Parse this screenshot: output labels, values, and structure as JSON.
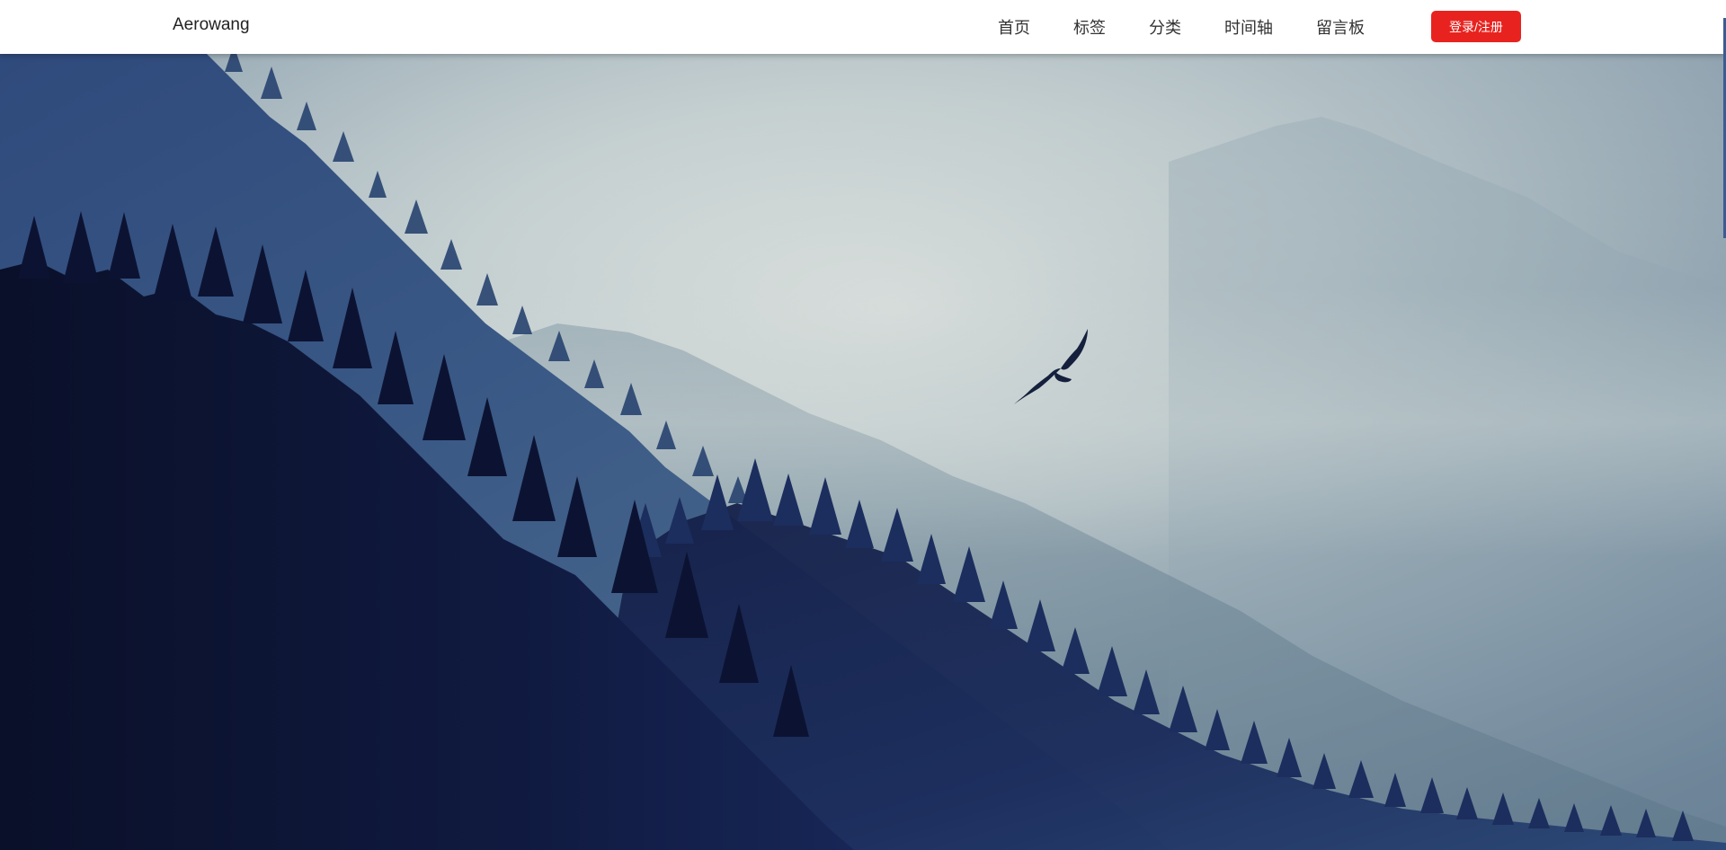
{
  "header": {
    "brand": "Aerowang",
    "nav": [
      {
        "label": "首页"
      },
      {
        "label": "标签"
      },
      {
        "label": "分类"
      },
      {
        "label": "时间轴"
      },
      {
        "label": "留言板"
      }
    ],
    "login_label": "登录/注册"
  },
  "colors": {
    "accent": "#e8231f",
    "header_bg": "#ffffff",
    "sky_light": "#dfe4df",
    "fog_blue": "#8fa6b3",
    "forest_dark": "#0d1533",
    "forest_mid": "#1d3466"
  },
  "hero": {
    "image": "misty-forest-with-eagle"
  }
}
